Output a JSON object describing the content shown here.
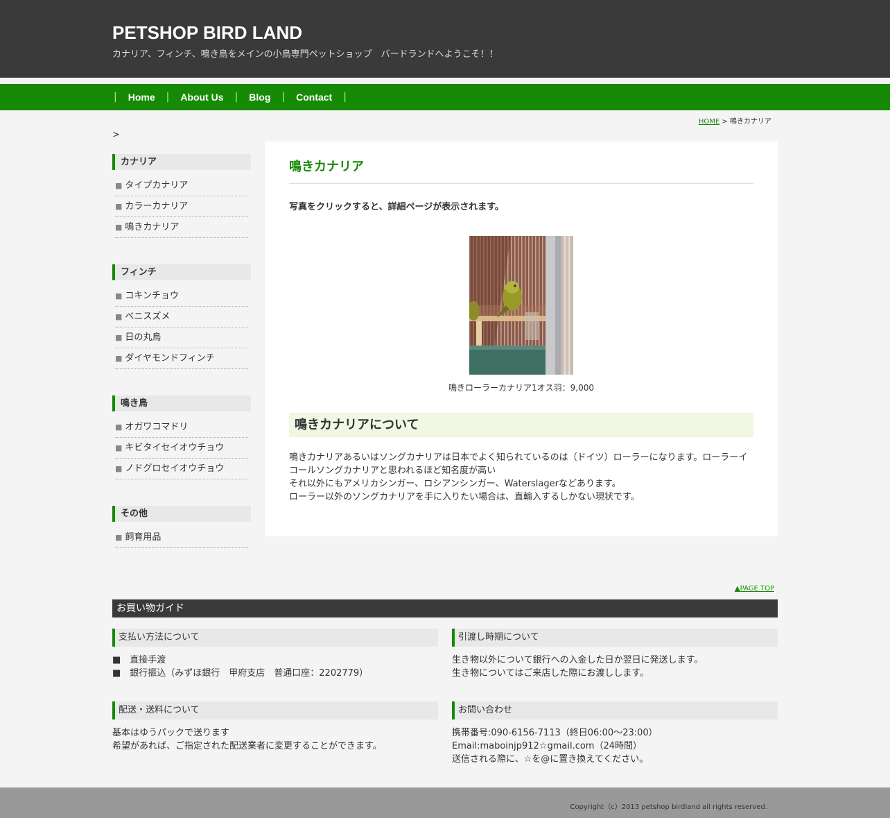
{
  "header": {
    "title": "PETSHOP BIRD LAND",
    "description": "カナリア、フィンチ、鳴き鳥をメインの小鳥専門ペットショップ　バードランドへようこそ！！"
  },
  "nav": {
    "separator": "|",
    "items": [
      "Home",
      "About Us",
      "Blog",
      "Contact"
    ]
  },
  "breadcrumb": {
    "home": "HOME",
    "sep": " > ",
    "current": "鳴きカナリア"
  },
  "stray_text": ">",
  "sidebar": {
    "bullet": "■",
    "sections": [
      {
        "title": "カナリア",
        "items": [
          "タイプカナリア",
          "カラーカナリア",
          "鳴きカナリア"
        ]
      },
      {
        "title": "フィンチ",
        "items": [
          "コキンチョウ",
          "ベニスズメ",
          "日の丸鳥",
          "ダイヤモンドフィンチ"
        ]
      },
      {
        "title": "鳴き鳥",
        "items": [
          "オガワコマドリ",
          "キビタイセイオウチョウ",
          "ノドグロセイオウチョウ"
        ]
      },
      {
        "title": "その他",
        "items": [
          "飼育用品"
        ]
      }
    ]
  },
  "main": {
    "title": "鳴きカナリア",
    "lead": "写真をクリックすると、詳細ページが表示されます。",
    "caption": "鳴きローラーカナリア1オス羽：9,000",
    "subheading": "鳴きカナリアについて",
    "body": [
      "鳴きカナリアあるいはソングカナリアは日本でよく知られているのは（ドイツ）ローラーになります。ローラーイコールソングカナリアと思われるほど知名度が高い",
      "それ以外にもアメリカシンガー、ロシアンシンガー、Waterslagerなどあります。",
      "ローラー以外のソングカナリアを手に入りたい場合は、直輸入するしかない現状です。"
    ]
  },
  "page_top": "▲PAGE TOP",
  "guide": {
    "title": "お買い物ガイド",
    "payment": {
      "title": "支払い方法について",
      "lines": [
        "■　直接手渡",
        "■　銀行振込（みずほ銀行　甲府支店　普通口座：2202779）"
      ]
    },
    "delivery_time": {
      "title": "引渡し時期について",
      "lines": [
        "生き物以外について銀行への入金した日か翌日に発送します。",
        "生き物についてはご来店した際にお渡しします。"
      ]
    },
    "shipping": {
      "title": "配送・送料について",
      "lines": [
        "基本はゆうパックで送ります",
        "希望があれば、ご指定された配送業者に変更することができます。"
      ]
    },
    "contact": {
      "title": "お問い合わせ",
      "lines": [
        "携帯番号:090-6156-7113（終日06:00～23:00）",
        "Email:maboinjp912☆gmail.com（24時間）",
        "送信される際に、☆を@に置き換えてください。"
      ]
    }
  },
  "footer": {
    "copyright": "Copyright（c）2013 petshop birdland all rights reserved."
  },
  "colors": {
    "accent": "#168a04",
    "header_bg": "#3a3a3a",
    "footer_bg": "#999999"
  }
}
